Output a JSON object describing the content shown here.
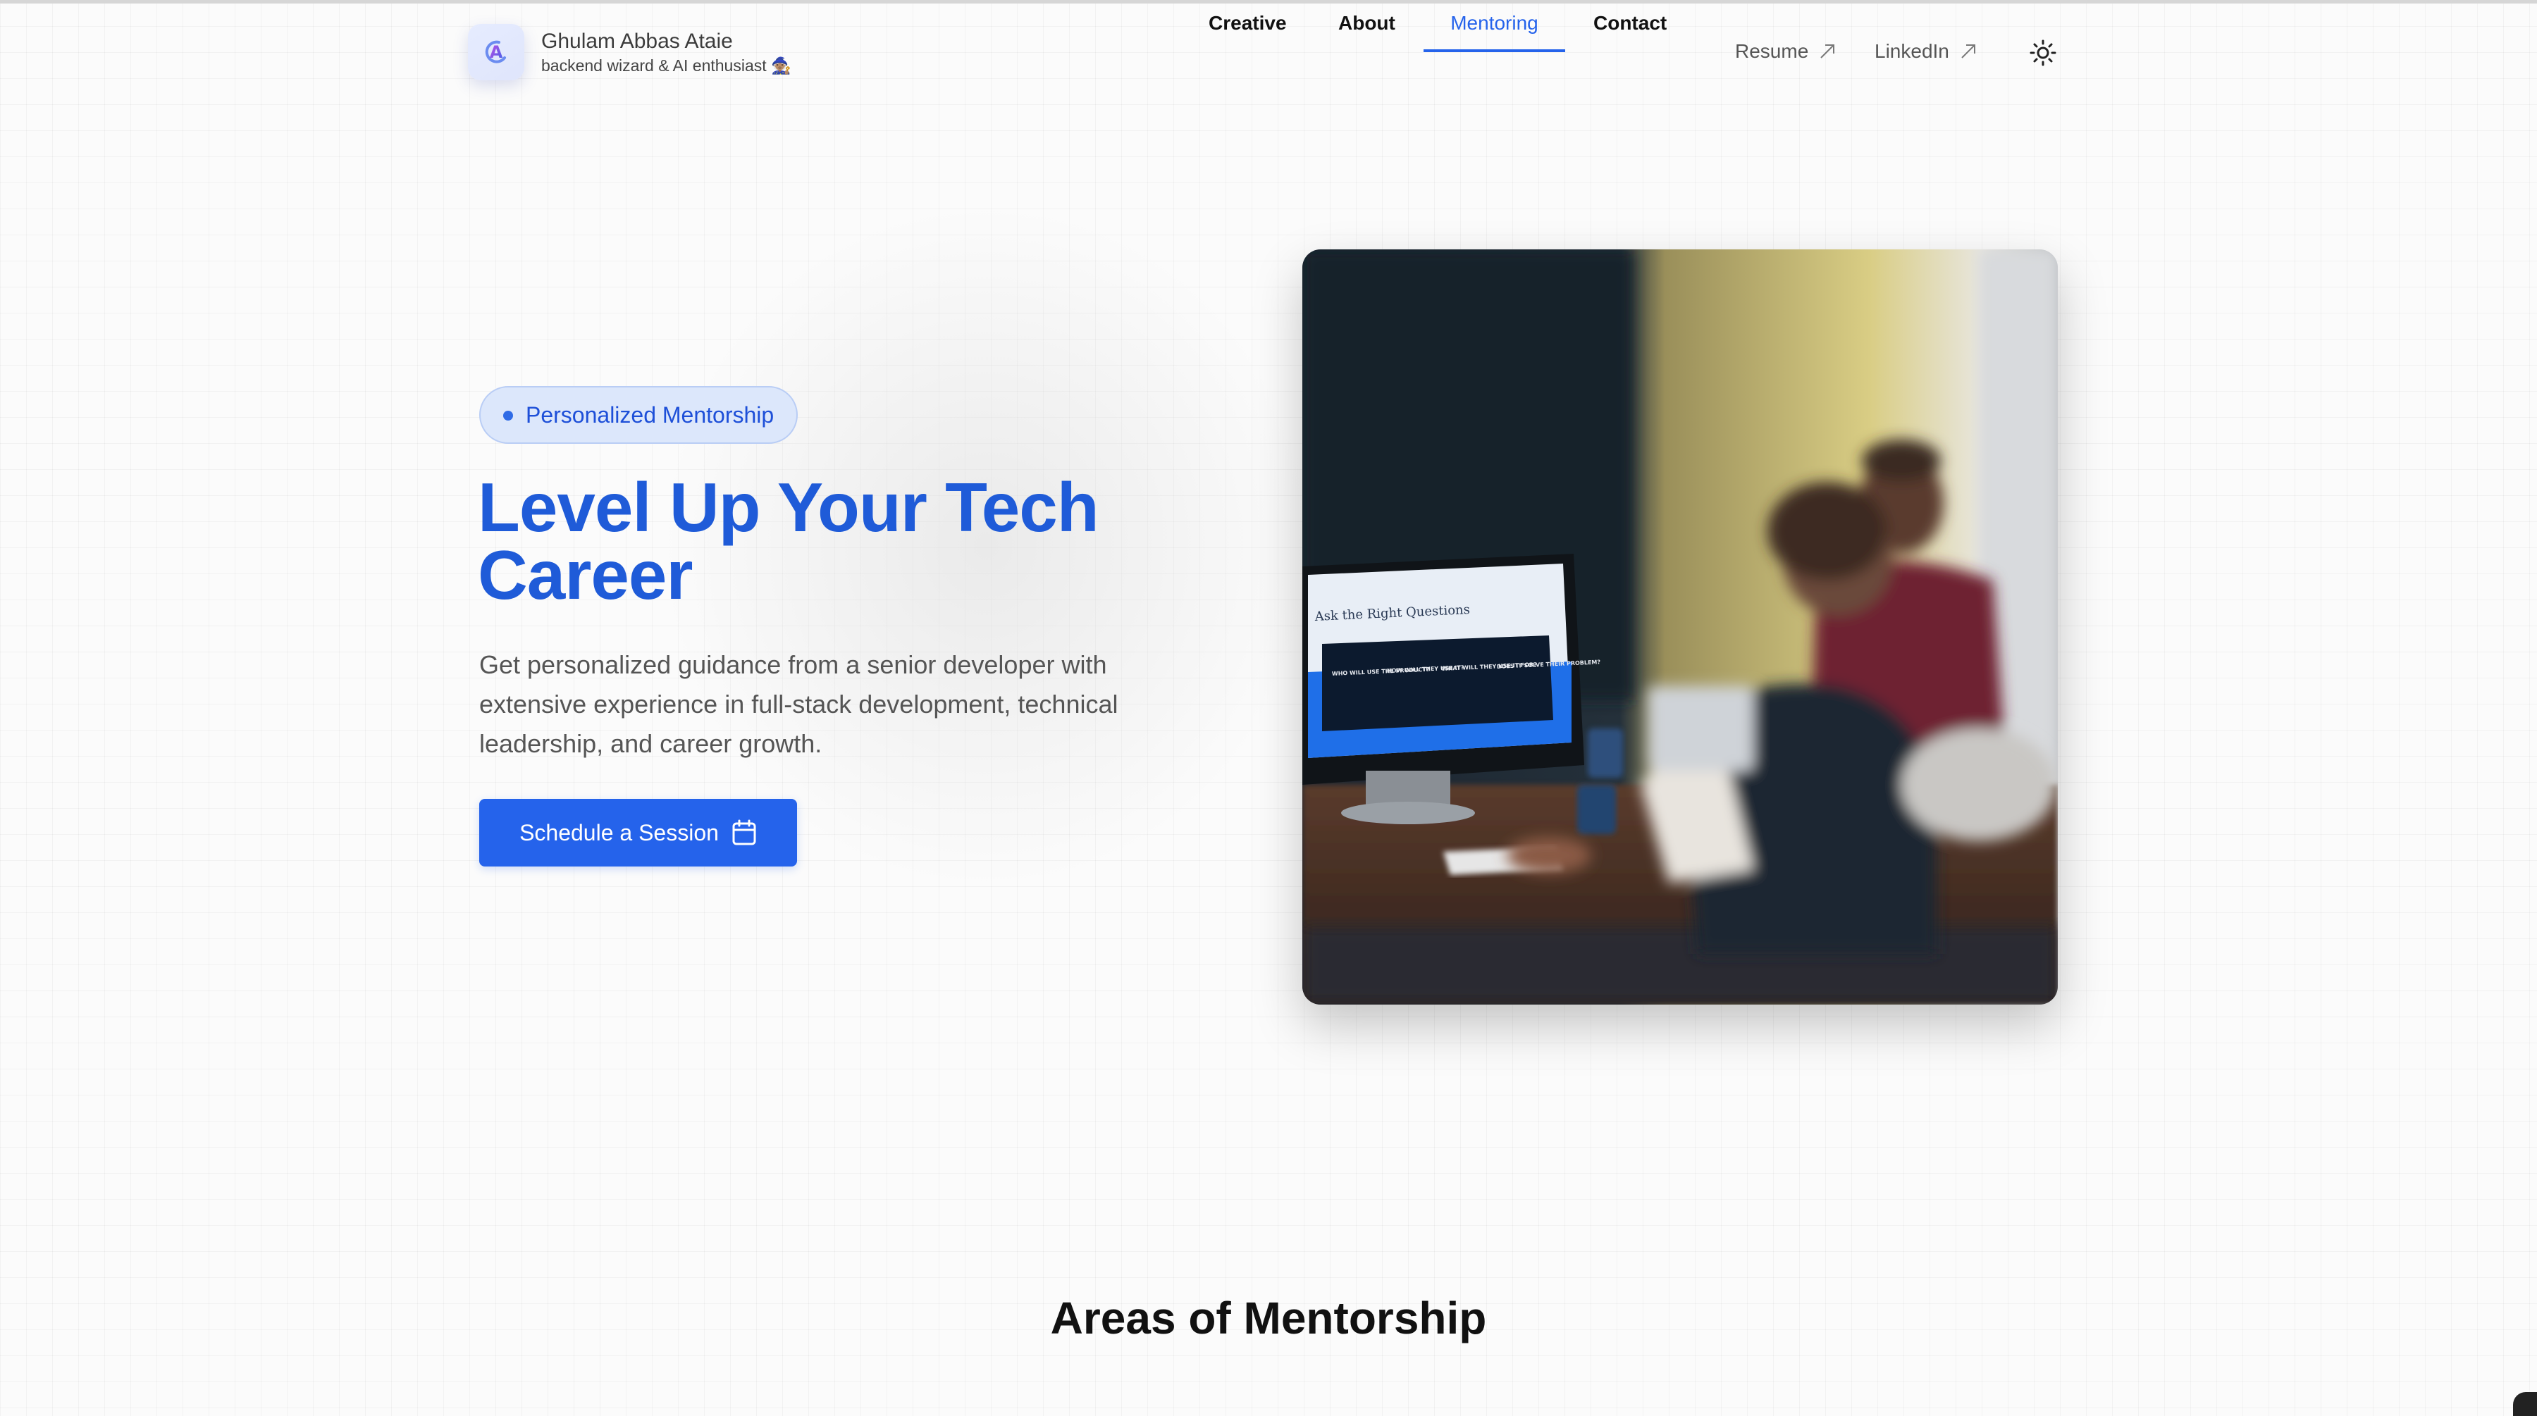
{
  "header": {
    "name": "Ghulam Abbas Ataie",
    "tagline": "backend wizard & AI enthusiast 🧙🏽",
    "logo_letter": "A",
    "nav": [
      {
        "label": "Creative",
        "active": false
      },
      {
        "label": "About",
        "active": false
      },
      {
        "label": "Mentoring",
        "active": true
      },
      {
        "label": "Contact",
        "active": false
      }
    ],
    "external_links": [
      {
        "label": "Resume",
        "icon": "arrow-up-right-icon"
      },
      {
        "label": "LinkedIn",
        "icon": "arrow-up-right-icon"
      }
    ],
    "theme_toggle_icon": "sun-icon"
  },
  "hero": {
    "badge": "Personalized Mentorship",
    "title": "Level Up Your Tech Career",
    "description": "Get personalized guidance from a senior developer with extensive experience in full-stack development, technical leadership, and career growth.",
    "cta_label": "Schedule a Session",
    "cta_icon": "calendar-icon",
    "photo": {
      "screen_heading": "Ask the Right Questions",
      "screen_columns": [
        "WHO WILL USE THE PRODUCT?",
        "HOW WILL THEY USE IT?",
        "WHAT WILL THEY USE IT FOR?",
        "DOES IT SOLVE THEIR PROBLEM?"
      ]
    }
  },
  "section": {
    "title": "Areas of Mentorship"
  },
  "colors": {
    "accent": "#2563eb",
    "badge_bg": "#dce7fb",
    "title_blue": "#1f5bd8"
  }
}
